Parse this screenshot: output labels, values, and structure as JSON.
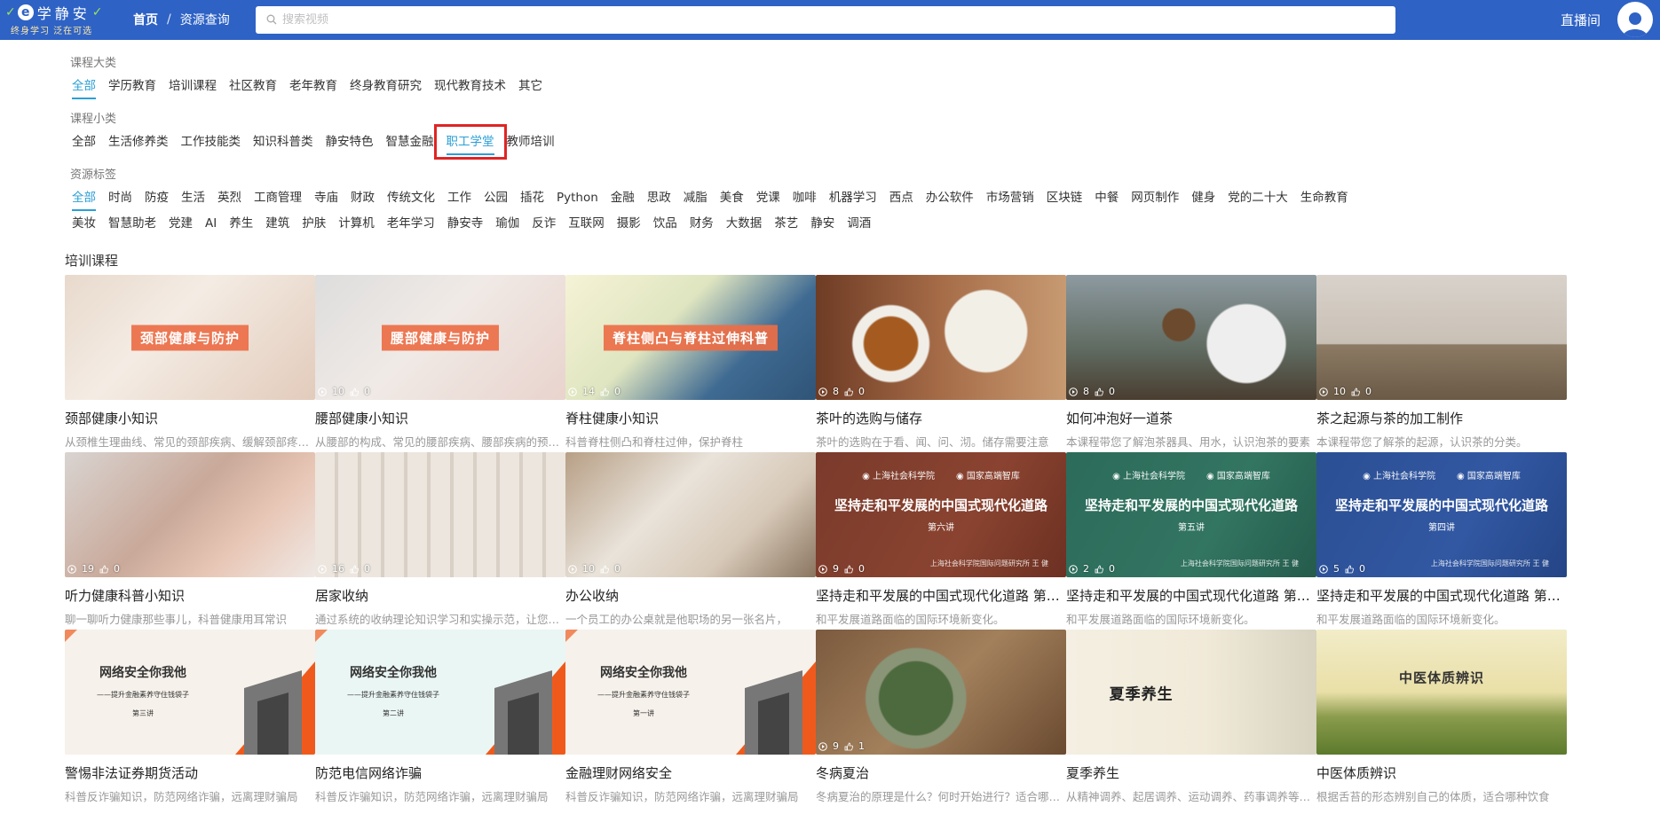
{
  "header": {
    "logo_title": "学静安",
    "logo_slogan": "终身学习 泛在可选",
    "breadcrumb_home": "首页",
    "breadcrumb_sep": "/",
    "breadcrumb_current": "资源查询",
    "search_placeholder": "搜索视频",
    "live_label": "直播间"
  },
  "filters": {
    "category_label": "课程大类",
    "categories": [
      "全部",
      "学历教育",
      "培训课程",
      "社区教育",
      "老年教育",
      "终身教育研究",
      "现代教育技术",
      "其它"
    ],
    "subcategory_label": "课程小类",
    "subcategories": [
      "全部",
      "生活修养类",
      "工作技能类",
      "知识科普类",
      "静安特色",
      "智慧金融",
      "职工学堂",
      "教师培训"
    ],
    "tags_label": "资源标签",
    "tags_row1": [
      "全部",
      "时尚",
      "防疫",
      "生活",
      "英烈",
      "工商管理",
      "寺庙",
      "财政",
      "传统文化",
      "工作",
      "公园",
      "插花",
      "Python",
      "金融",
      "思政",
      "减脂",
      "美食",
      "党课",
      "咖啡",
      "机器学习",
      "西点",
      "办公软件",
      "市场营销",
      "区块链",
      "中餐",
      "网页制作",
      "健身",
      "党的二十大",
      "生命教育"
    ],
    "tags_row2": [
      "美妆",
      "智慧助老",
      "党建",
      "AI",
      "养生",
      "建筑",
      "护肤",
      "计算机",
      "老年学习",
      "静安寺",
      "瑜伽",
      "反诈",
      "互联网",
      "摄影",
      "饮品",
      "财务",
      "大数据",
      "茶艺",
      "静安",
      "调酒"
    ]
  },
  "section_title": "培训课程",
  "courses": [
    {
      "title": "颈部健康小知识",
      "desc": "从颈椎生理曲线、常见的颈部疾病、缓解颈部疼痛的方法等方面进行讲解",
      "overlay": "颈部健康与防护",
      "views": "",
      "likes": ""
    },
    {
      "title": "腰部健康小知识",
      "desc": "从腰部的构成、常见的腰部疾病、腰部疾病的预防方面进行讲解",
      "overlay": "腰部健康与防护",
      "views": "10",
      "likes": "0"
    },
    {
      "title": "脊柱健康小知识",
      "desc": "科普脊柱侧凸和脊柱过伸，保护脊柱",
      "overlay": "脊柱侧凸与脊柱过伸科普",
      "views": "14",
      "likes": "0"
    },
    {
      "title": "茶叶的选购与储存",
      "desc": "茶叶的选购在于看、闻、问、沏。储存需要注意",
      "overlay": "",
      "views": "8",
      "likes": "0"
    },
    {
      "title": "如何冲泡好一道茶",
      "desc": "本课程带您了解泡茶器具、用水，认识泡茶的要素",
      "overlay": "",
      "views": "8",
      "likes": "0"
    },
    {
      "title": "茶之起源与茶的加工制作",
      "desc": "本课程带您了解茶的起源，认识茶的分类。",
      "overlay": "",
      "views": "10",
      "likes": "0"
    },
    {
      "title": "听力健康科普小知识",
      "desc": "聊一聊听力健康那些事儿，科普健康用耳常识",
      "overlay": "",
      "views": "19",
      "likes": "0"
    },
    {
      "title": "居家收纳",
      "desc": "通过系统的收纳理论知识学习和实操示范，让您轻松收纳",
      "overlay": "",
      "views": "16",
      "likes": "0"
    },
    {
      "title": "办公收纳",
      "desc": "一个员工的办公桌就是他职场的另一张名片，",
      "overlay": "",
      "views": "10",
      "likes": "0"
    },
    {
      "title": "坚持走和平发展的中国式现代化道路 第六讲",
      "desc": "和平发展道路面临的国际环境新变化。",
      "poster_title": "坚持走和平发展的中国式现代化道路",
      "poster_sub": "第六讲",
      "views": "9",
      "likes": "0"
    },
    {
      "title": "坚持走和平发展的中国式现代化道路 第五讲",
      "desc": "和平发展道路面临的国际环境新变化。",
      "poster_title": "坚持走和平发展的中国式现代化道路",
      "poster_sub": "第五讲",
      "views": "2",
      "likes": "0"
    },
    {
      "title": "坚持走和平发展的中国式现代化道路 第四讲",
      "desc": "和平发展道路面临的国际环境新变化。",
      "poster_title": "坚持走和平发展的中国式现代化道路",
      "poster_sub": "第四讲",
      "views": "5",
      "likes": "0"
    },
    {
      "title": "警惕非法证券期货活动",
      "desc": "科普反诈骗知识，防范网络诈骗，远离理财骗局",
      "poster_title": "网络安全你我他",
      "poster_sub": "——提升金融素养守住钱袋子",
      "poster_lec": "第三讲",
      "views": "",
      "likes": ""
    },
    {
      "title": "防范电信网络诈骗",
      "desc": "科普反诈骗知识，防范网络诈骗，远离理财骗局",
      "poster_title": "网络安全你我他",
      "poster_sub": "——提升金融素养守住钱袋子",
      "poster_lec": "第二讲",
      "views": "",
      "likes": ""
    },
    {
      "title": "金融理财网络安全",
      "desc": "科普反诈骗知识，防范网络诈骗，远离理财骗局",
      "poster_title": "网络安全你我他",
      "poster_sub": "——提升金融素养守住钱袋子",
      "poster_lec": "第一讲",
      "views": "",
      "likes": ""
    },
    {
      "title": "冬病夏治",
      "desc": "冬病夏治的原理是什么？何时开始进行？适合哪些人群？",
      "overlay": "",
      "views": "9",
      "likes": "1"
    },
    {
      "title": "夏季养生",
      "desc": "从精神调养、起居调养、运动调养、药事调养等方面讲解",
      "overlay": "夏季养生",
      "views": "",
      "likes": ""
    },
    {
      "title": "中医体质辨识",
      "desc": "根据舌苔的形态辨别自己的体质，适合哪种饮食",
      "overlay": "中医体质辨识",
      "views": "",
      "likes": ""
    }
  ],
  "poster_orgs": [
    "上海社会科学院",
    "国家高端智库"
  ],
  "poster_foot": "上海社会科学院国际问题研究所  王 健"
}
